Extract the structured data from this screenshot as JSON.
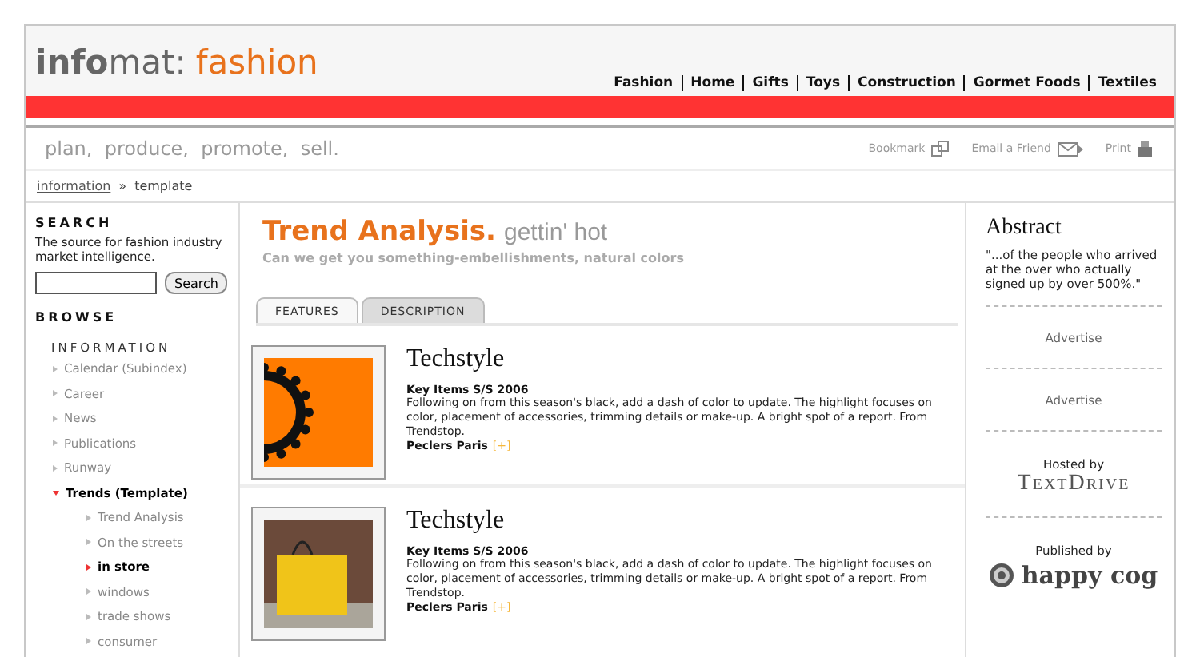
{
  "logo": {
    "name": "**info**mat:",
    "section": "fashion"
  },
  "nav": [
    {
      "label": "Fashion"
    },
    {
      "label": "Home"
    },
    {
      "label": "Gifts"
    },
    {
      "label": "Toys"
    },
    {
      "label": "Construction"
    },
    {
      "label": "Gormet Foods"
    },
    {
      "label": "Textiles"
    }
  ],
  "tagline": "plan,  produce,  promote,  sell.",
  "tools": [
    {
      "label": "Bookmark",
      "kind": "bookmark"
    },
    {
      "label": "Email a Friend",
      "kind": "email"
    },
    {
      "label": "Print",
      "kind": "print"
    }
  ],
  "breadcrumb": {
    "link": "information",
    "separator": "»",
    "current": "template"
  },
  "sidebar": {
    "search_title": "SEARCH",
    "search_text": "The source for fashion industry market intelligence.",
    "search_button": "Search",
    "browse_title": "BROWSE",
    "section": "INFORMATION",
    "items": [
      {
        "label": "Calendar (Subindex)",
        "expanded": false
      },
      {
        "label": "Career",
        "expanded": false
      },
      {
        "label": "News",
        "expanded": false
      },
      {
        "label": "Publications",
        "expanded": false
      },
      {
        "label": "Runway",
        "expanded": false
      },
      {
        "label": "Trends (Template)",
        "expanded": true,
        "children": [
          {
            "label": "Trend Analysis",
            "selected": false
          },
          {
            "label": "On the streets",
            "selected": false
          },
          {
            "label": "in store",
            "selected": true
          },
          {
            "label": "windows",
            "selected": false
          },
          {
            "label": "trade shows",
            "selected": false
          },
          {
            "label": "consumer",
            "selected": false
          }
        ]
      }
    ]
  },
  "main": {
    "title": "Trend Analysis.",
    "subtitle": "gettin' hot",
    "lead": "Can we get you something-embellishments, natural colors",
    "tabs": [
      {
        "label": "FEATURES",
        "selected": true
      },
      {
        "label": "DESCRIPTION",
        "selected": false
      }
    ],
    "articles": [
      {
        "kind": "graphic",
        "title": "Techstyle",
        "heading": "Key Items S/S 2006",
        "text": "Following on from this season's black, add a dash of color to update. The highlight focuses on color, placement of accessories, trimming details or make-up. A bright spot of a report. From Trendstop.",
        "source": "Peclers Paris",
        "more": "[+]"
      },
      {
        "kind": "photo",
        "title": "Techstyle",
        "heading": "Key Items S/S 2006",
        "text": "Following on from this season's black, add a dash of color to update. The highlight focuses on color, placement of accessories, trimming details or make-up. A bright spot of a report. From Trendstop.",
        "source": "Peclers Paris",
        "more": "[+]"
      }
    ]
  },
  "aside": {
    "title": "Abstract",
    "quote": "\"...of the people who arrived at the over who actually signed up by over 500%.\"",
    "ads": [
      "Advertise",
      "Advertise"
    ],
    "hosted_label": "Hosted by",
    "host": "TextDrive",
    "published_label": "Published by",
    "publisher": "happy cog"
  }
}
